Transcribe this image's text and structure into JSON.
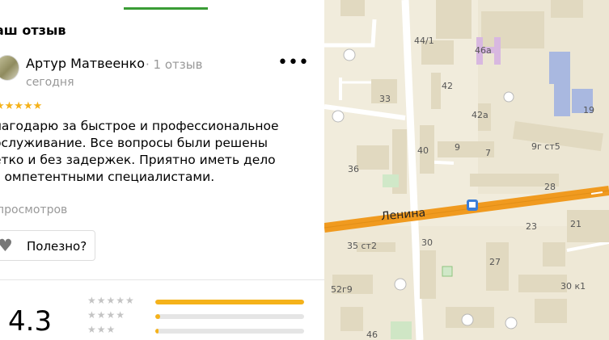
{
  "review": {
    "section_title": "аш отзыв",
    "author": "Артур Матвеенко",
    "author_meta": "· 1 отзыв",
    "date": "сегодня",
    "stars": "★★★★★",
    "text": "лагодарю за быстрое и профессиональное бслуживание. Все вопросы были решены етко и без задержек. Приятно иметь дело с омпетентными специалистами.",
    "views": "просмотров",
    "helpful_label": "Полезно?",
    "more_icon": "more-dots-icon"
  },
  "rating": {
    "value": "4.3",
    "distribution": [
      {
        "stars": "★★★★★",
        "fraction": 1.0
      },
      {
        "stars": "★★★★",
        "fraction": 0.03
      },
      {
        "stars": "★★★",
        "fraction": 0.02
      }
    ],
    "accent_color": "#f5b21a"
  },
  "map": {
    "street_name": "Ленина",
    "labels": [
      "44/1",
      "46а",
      "42",
      "33",
      "42а",
      "19",
      "40",
      "9",
      "7",
      "9г ст5",
      "36",
      "28",
      "21",
      "35 ст2",
      "30",
      "23",
      "27",
      "30 к1",
      "52г9",
      "46"
    ]
  }
}
